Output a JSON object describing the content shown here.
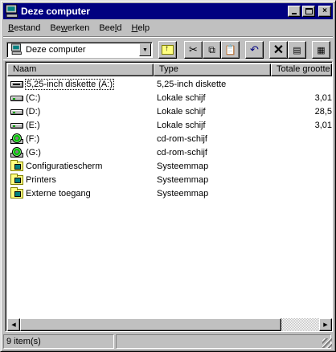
{
  "window": {
    "title": "Deze computer",
    "icon": "computer-icon",
    "buttons": {
      "minimize": "_",
      "maximize": "□",
      "close": "×"
    }
  },
  "menu": [
    "Bestand",
    "Bewerken",
    "Beeld",
    "Help"
  ],
  "menu_underline": [
    "B",
    "w",
    "l",
    "H"
  ],
  "address": {
    "value": "Deze computer",
    "icon": "computer-icon"
  },
  "toolbar": {
    "up_icon": "up-folder-icon",
    "cut_icon": "scissors-icon",
    "copy_icon": "copy-icon",
    "paste_icon": "paste-icon",
    "undo_icon": "undo-icon",
    "delete_icon": "delete-x-icon",
    "properties_icon": "properties-icon",
    "views_icon": "large-icons-view-icon"
  },
  "columns": {
    "name": "Naam",
    "type": "Type",
    "size": "Totale grootte"
  },
  "items": [
    {
      "name": "5,25-inch diskette (A:)",
      "type": "5,25-inch diskette",
      "size": "",
      "icon": "floppy"
    },
    {
      "name": "(C:)",
      "type": "Lokale schijf",
      "size": "3,01",
      "icon": "hdd"
    },
    {
      "name": "(D:)",
      "type": "Lokale schijf",
      "size": "28,5",
      "icon": "hdd"
    },
    {
      "name": "(E:)",
      "type": "Lokale schijf",
      "size": "3,01",
      "icon": "hdd"
    },
    {
      "name": "(F:)",
      "type": "cd-rom-schijf",
      "size": "",
      "icon": "cd"
    },
    {
      "name": "(G:)",
      "type": "cd-rom-schijf",
      "size": "",
      "icon": "cd"
    },
    {
      "name": "Configuratiescherm",
      "type": "Systeemmap",
      "size": "",
      "icon": "folder"
    },
    {
      "name": "Printers",
      "type": "Systeemmap",
      "size": "",
      "icon": "folder"
    },
    {
      "name": "Externe toegang",
      "type": "Systeemmap",
      "size": "",
      "icon": "folder"
    }
  ],
  "status": {
    "count": "9 item(s)",
    "extra": ""
  },
  "colors": {
    "titlebar": "#000080",
    "face": "#c0c0c0",
    "desktop": "#008080"
  }
}
